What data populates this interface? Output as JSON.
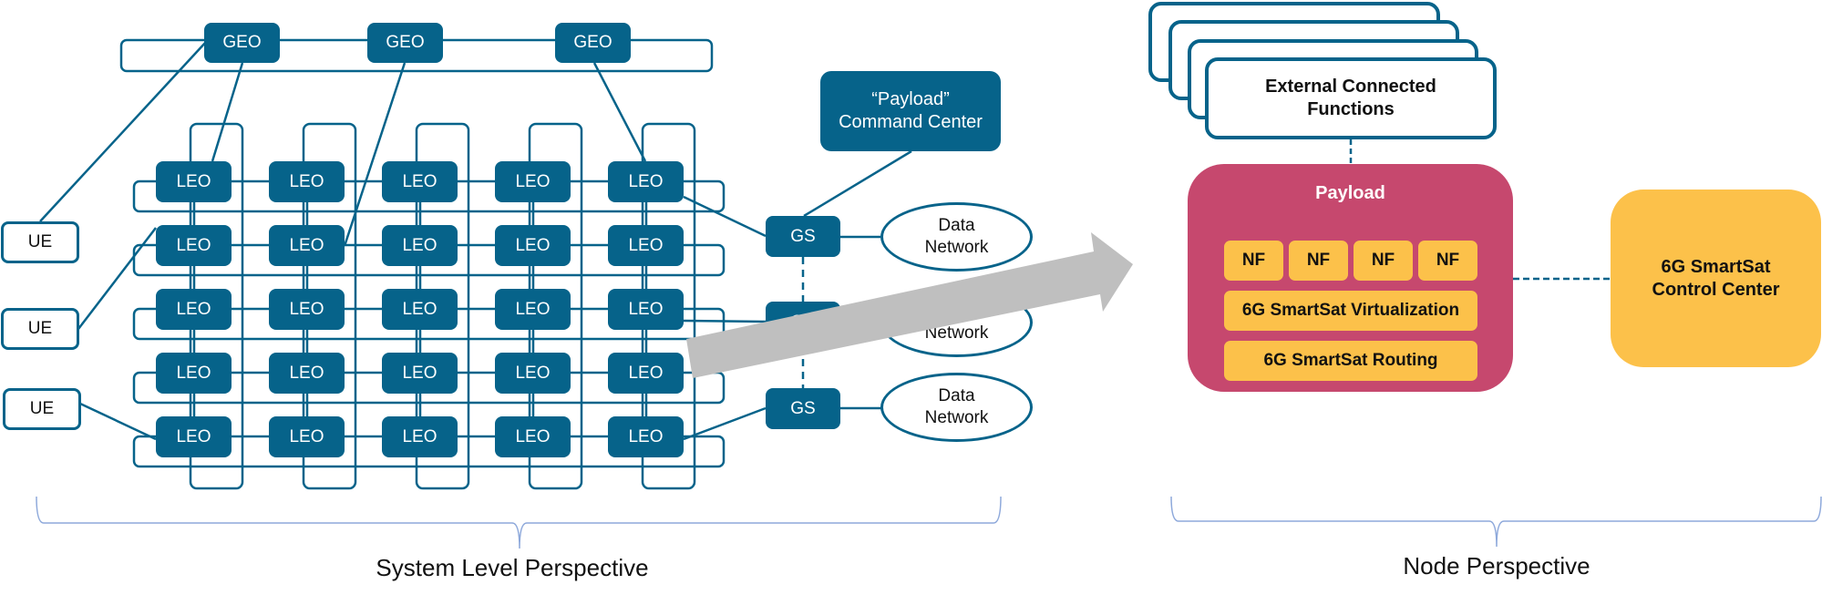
{
  "system_level": {
    "geo_nodes": [
      {
        "label": "GEO"
      },
      {
        "label": "GEO"
      },
      {
        "label": "GEO"
      }
    ],
    "leo_grid": {
      "rows": 5,
      "cols": 5,
      "label": "LEO"
    },
    "ue_nodes": [
      {
        "label": "UE"
      },
      {
        "label": "UE"
      },
      {
        "label": "UE"
      }
    ],
    "ground_stations": [
      {
        "label": "GS"
      },
      {
        "label": "GS"
      },
      {
        "label": "GS"
      }
    ],
    "data_networks": [
      {
        "line1": "Data",
        "line2": "Network"
      },
      {
        "line1": "Data",
        "line2": "Network"
      },
      {
        "line1": "Data",
        "line2": "Network"
      }
    ],
    "command_center": {
      "line1": "“Payload”",
      "line2": "Command Center"
    },
    "caption": "System Level Perspective"
  },
  "node_level": {
    "external_functions": {
      "line1": "External Connected",
      "line2": "Functions",
      "stack_count": 4
    },
    "payload": {
      "title": "Payload",
      "nf_boxes": [
        {
          "label": "NF"
        },
        {
          "label": "NF"
        },
        {
          "label": "NF"
        },
        {
          "label": "NF"
        }
      ],
      "virtualization": "6G SmartSat Virtualization",
      "routing": "6G SmartSat Routing"
    },
    "control_center": {
      "line1": "6G SmartSat",
      "line2": "Control Center"
    },
    "caption": "Node Perspective"
  },
  "colors": {
    "teal": "#06638A",
    "payload_magenta": "#C6486E",
    "yellow": "#FCC14A",
    "arrow_gray": "#BFBFBF",
    "brace_blue": "#8EA9DB"
  }
}
